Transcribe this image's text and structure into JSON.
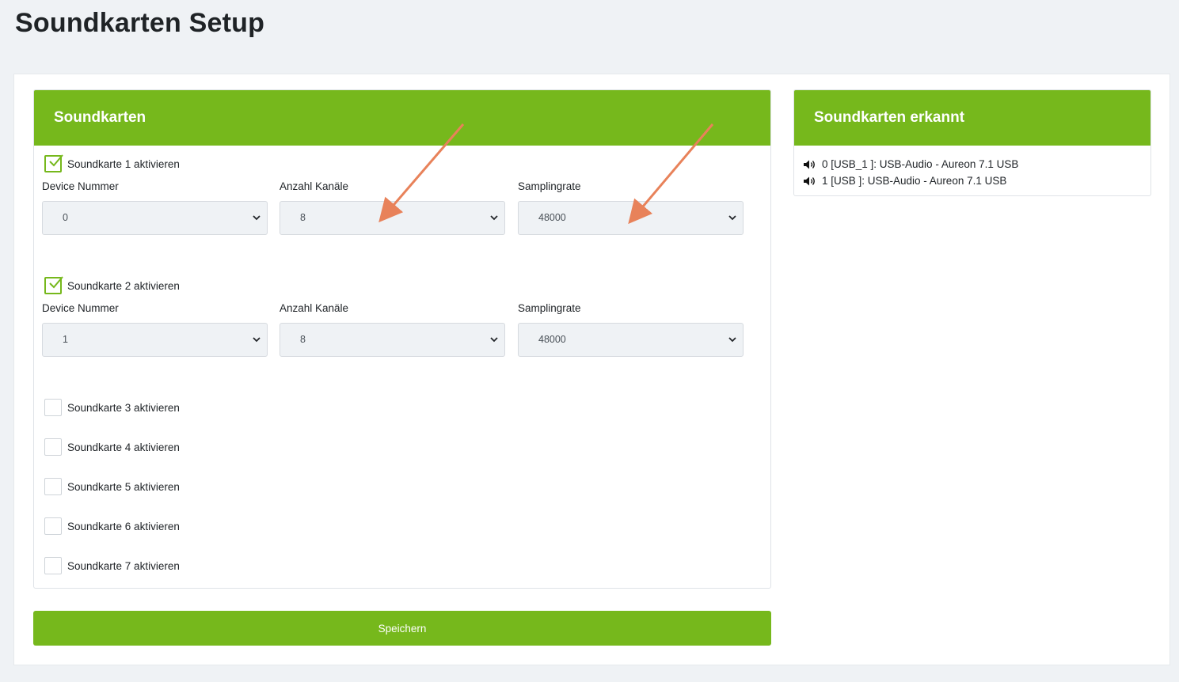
{
  "page": {
    "title": "Soundkarten Setup"
  },
  "soundcards_card": {
    "title": "Soundkarten",
    "cards": [
      {
        "checkbox_label": "Soundkarte 1 aktivieren",
        "checked": true,
        "device_label": "Device Nummer",
        "device_value": "0",
        "channels_label": "Anzahl Kanäle",
        "channels_value": "8",
        "rate_label": "Samplingrate",
        "rate_value": "48000"
      },
      {
        "checkbox_label": "Soundkarte 2 aktivieren",
        "checked": true,
        "device_label": "Device Nummer",
        "device_value": "1",
        "channels_label": "Anzahl Kanäle",
        "channels_value": "8",
        "rate_label": "Samplingrate",
        "rate_value": "48000"
      },
      {
        "checkbox_label": "Soundkarte 3 aktivieren",
        "checked": false
      },
      {
        "checkbox_label": "Soundkarte 4 aktivieren",
        "checked": false
      },
      {
        "checkbox_label": "Soundkarte 5 aktivieren",
        "checked": false
      },
      {
        "checkbox_label": "Soundkarte 6 aktivieren",
        "checked": false
      },
      {
        "checkbox_label": "Soundkarte 7 aktivieren",
        "checked": false
      }
    ]
  },
  "detected_card": {
    "title": "Soundkarten erkannt",
    "items": [
      {
        "icon": "speaker-icon",
        "text": "0 [USB_1 ]: USB-Audio - Aureon 7.1 USB"
      },
      {
        "icon": "speaker-icon",
        "text": "1 [USB ]: USB-Audio - Aureon 7.1 USB"
      }
    ]
  },
  "actions": {
    "save_label": "Speichern"
  },
  "colors": {
    "accent": "#76b81c",
    "annotation_arrow": "#e8825a",
    "background": "#eff2f5"
  }
}
